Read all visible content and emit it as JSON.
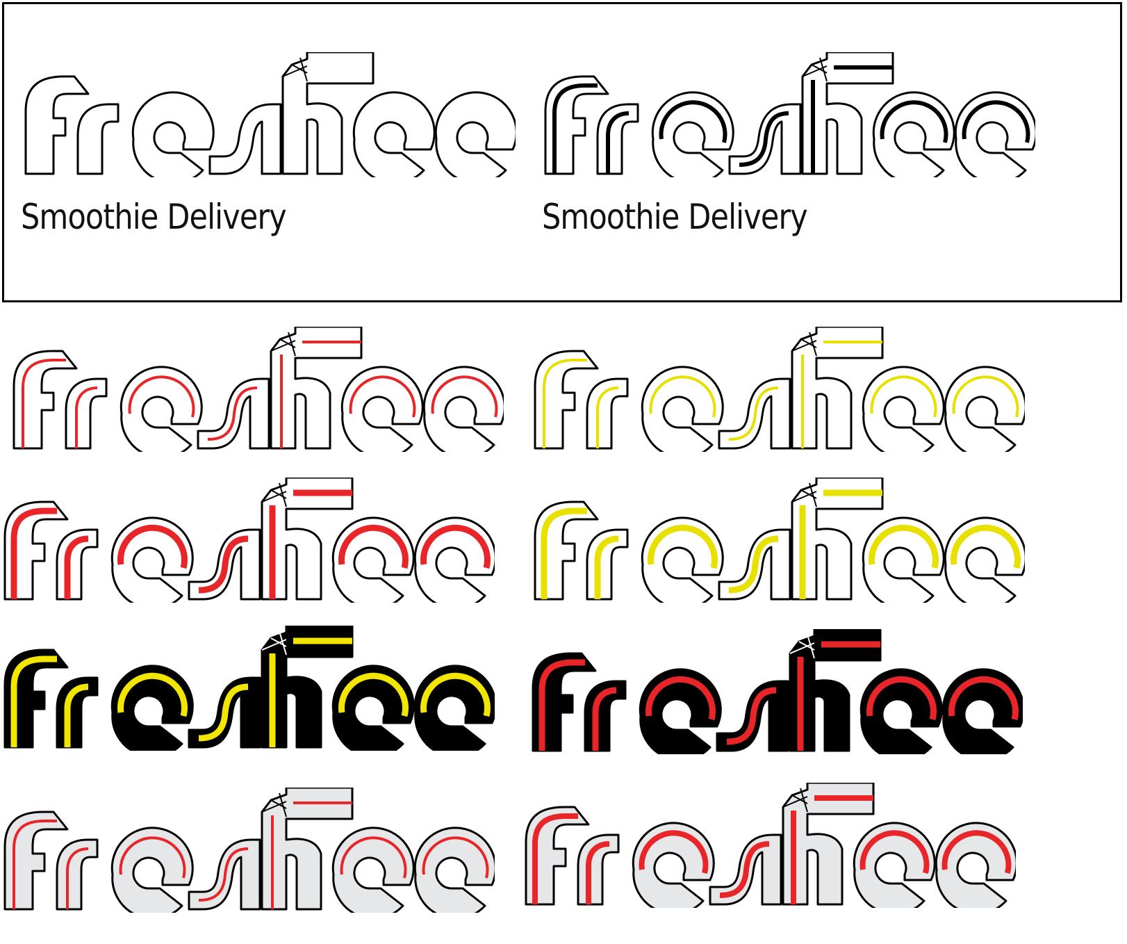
{
  "header_sheet": {
    "left": {
      "tagline": "Smoothie Delivery"
    },
    "right": {
      "tagline": "Smoothie Delivery"
    }
  },
  "variants": [
    {
      "id": "outline-plain",
      "fill": "#ffffff",
      "stroke": "#000000",
      "stripe": "none",
      "stripe_width": 0
    },
    {
      "id": "outline-black-stripe",
      "fill": "#ffffff",
      "stroke": "#000000",
      "stripe": "#000000",
      "stripe_width": 6
    },
    {
      "id": "red-thin",
      "fill": "#ffffff",
      "stroke": "#000000",
      "stripe": "#e8262a",
      "stripe_width": 4
    },
    {
      "id": "yellow-thin",
      "fill": "#ffffff",
      "stroke": "#000000",
      "stripe": "#e8e000",
      "stripe_width": 4
    },
    {
      "id": "red-thick",
      "fill": "#ffffff",
      "stroke": "#000000",
      "stripe": "#e8262a",
      "stripe_width": 9
    },
    {
      "id": "yellow-thick",
      "fill": "#ffffff",
      "stroke": "#000000",
      "stripe": "#e8e000",
      "stripe_width": 9
    },
    {
      "id": "black-yellow",
      "fill": "#000000",
      "stroke": "#000000",
      "stripe": "#f2e600",
      "stripe_width": 9
    },
    {
      "id": "black-red",
      "fill": "#000000",
      "stroke": "#000000",
      "stripe": "#e8262a",
      "stripe_width": 9
    },
    {
      "id": "grey-red-thin",
      "fill": "#e6e7e8",
      "stroke": "#000000",
      "stripe": "#e8262a",
      "stripe_width": 4
    },
    {
      "id": "grey-red-thick",
      "fill": "#e6e7e8",
      "stroke": "#000000",
      "stripe": "#e8262a",
      "stripe_width": 8
    }
  ]
}
